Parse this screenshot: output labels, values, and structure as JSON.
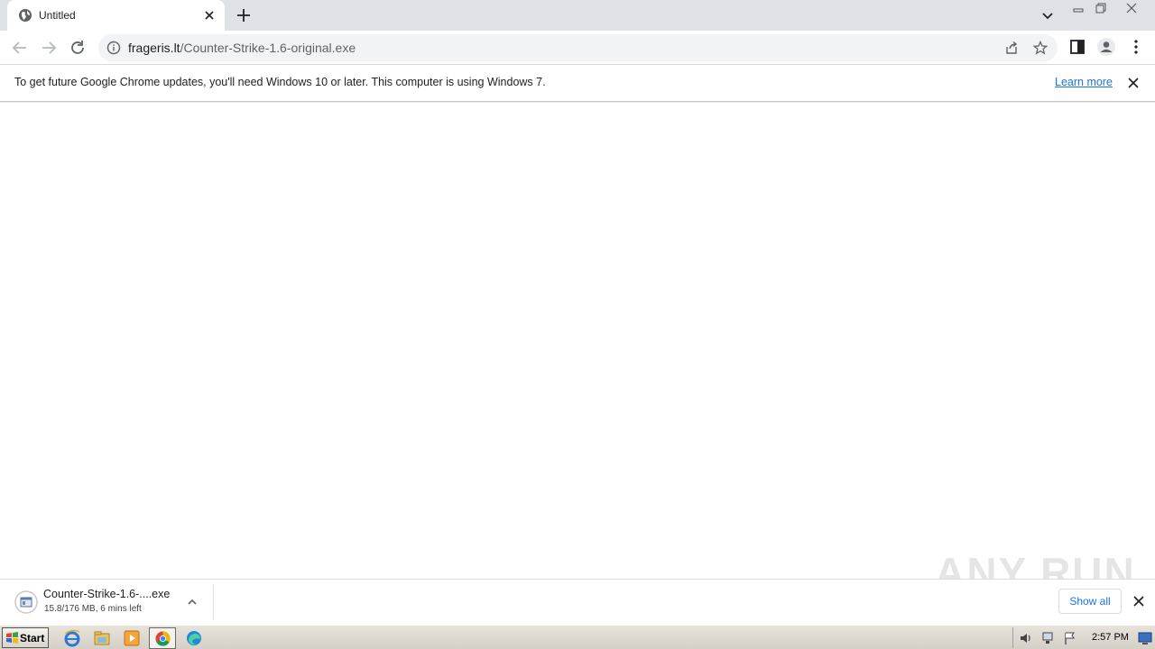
{
  "tab": {
    "title": "Untitled"
  },
  "omnibox": {
    "domain": "frageris.lt",
    "path": "/Counter-Strike-1.6-original.exe"
  },
  "infobar": {
    "message": "To get future Google Chrome updates, you'll need Windows 10 or later. This computer is using Windows 7.",
    "link": "Learn more"
  },
  "download": {
    "filename": "Counter-Strike-1.6-....exe",
    "status": "15.8/176 MB, 6 mins left",
    "show_all": "Show all"
  },
  "watermark": "ANY RUN",
  "taskbar": {
    "start_label": "Start",
    "clock": "2:57 PM"
  },
  "colors": {
    "accent": "#1a73e8",
    "tabstrip": "#dee1e6",
    "omnibox": "#f1f3f4"
  }
}
